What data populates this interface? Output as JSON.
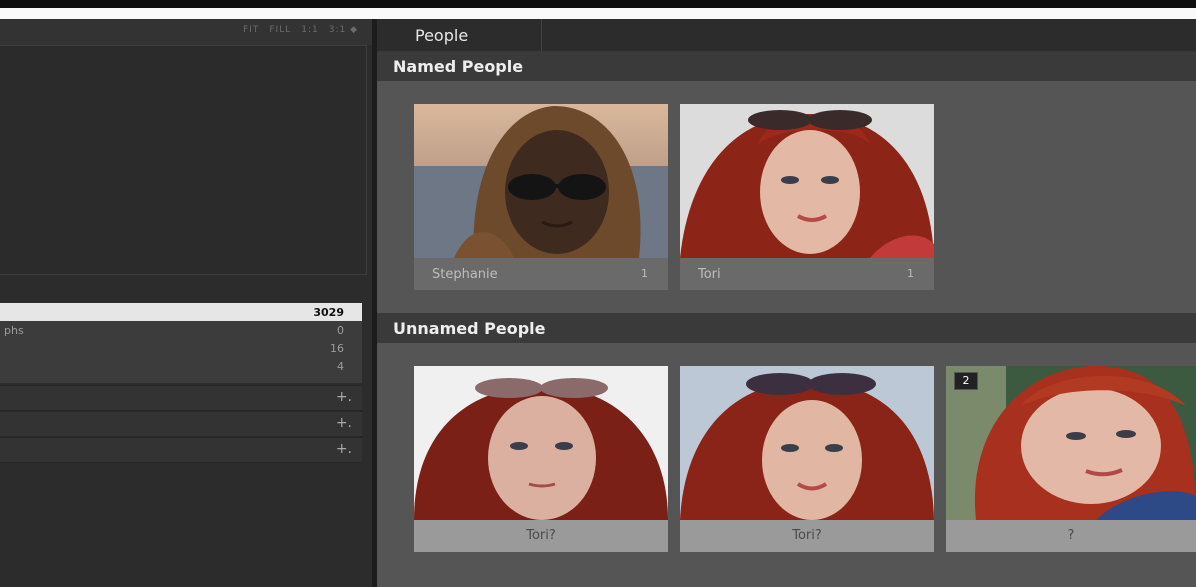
{
  "navigator": {
    "zoom_options": [
      "FIT",
      "FILL",
      "1:1",
      "3:1 ◆"
    ]
  },
  "catalog": {
    "rows": [
      {
        "label": "",
        "count": "3029"
      },
      {
        "label": "phs",
        "count": "0"
      },
      {
        "label": "",
        "count": "16"
      },
      {
        "label": "",
        "count": "4"
      }
    ]
  },
  "sections": {
    "plus": "+."
  },
  "tab": {
    "label": "People"
  },
  "named": {
    "title": "Named People",
    "people": [
      {
        "name": "Stephanie",
        "count": "1"
      },
      {
        "name": "Tori",
        "count": "1"
      }
    ]
  },
  "unnamed": {
    "title": "Unnamed People",
    "people": [
      {
        "name": "Tori?"
      },
      {
        "name": "Tori?"
      },
      {
        "name": "?",
        "stack_count": "2"
      }
    ]
  }
}
